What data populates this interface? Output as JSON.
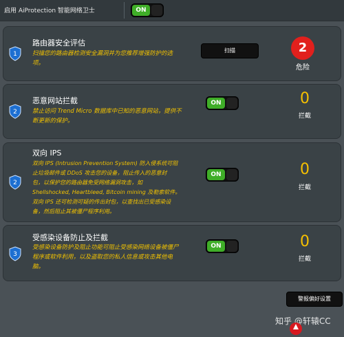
{
  "header": {
    "label": "启用 AiProtection 智能网络卫士",
    "toggle_text": "ON"
  },
  "cards": [
    {
      "title": "路由器安全评估",
      "desc_lines": [
        "扫描您的路由器检测安全漏洞并为您推荐增强防护的选",
        "项。"
      ],
      "action": "扫描",
      "count": "2",
      "count_label": "危险",
      "icon_number": "1"
    },
    {
      "title": "恶意网站拦截",
      "desc_lines": [
        "禁止访问 Trend Micro 数据库中已知的恶意网站，提供不",
        "断更新的保护。"
      ],
      "toggle_text": "ON",
      "count": "0",
      "count_label": "拦截",
      "icon_number": "2"
    },
    {
      "title": "双向 IPS",
      "desc_lines": [
        "双向 IPS (Intrusion Prevention System) 防入侵系统可阻",
        "止垃圾邮件或 DDoS 攻击您的设备，阻止传入的恶意封",
        "包，以保护您的路由器免受网络漏洞攻击，如",
        "Shellshocked, Heartbleed, Bitcoin mining 及勒索软件。",
        "双向 IPS 还可检测可疑的传出封包，以查找出已受感染设",
        "备，然后阻止其被僵尸程序利用。"
      ],
      "toggle_text": "ON",
      "count": "0",
      "count_label": "拦截",
      "icon_number": "2"
    },
    {
      "title": "受感染设备防止及拦截",
      "desc_lines": [
        "受感染设备防护及阻止功能可阻止受感染网络设备被僵尸",
        "程序或软件利用，以及盗取您的私人信息或攻击其他电",
        "脑。"
      ],
      "toggle_text": "ON",
      "count": "0",
      "count_label": "拦截",
      "icon_number": "3"
    }
  ],
  "footer": {
    "prefs_button": "警报偏好设置",
    "watermark": "知乎 @轩辕CC"
  },
  "colors": {
    "accent_yellow": "#f2c200",
    "danger_red": "#e1201d",
    "toggle_green": "#3fae28"
  }
}
